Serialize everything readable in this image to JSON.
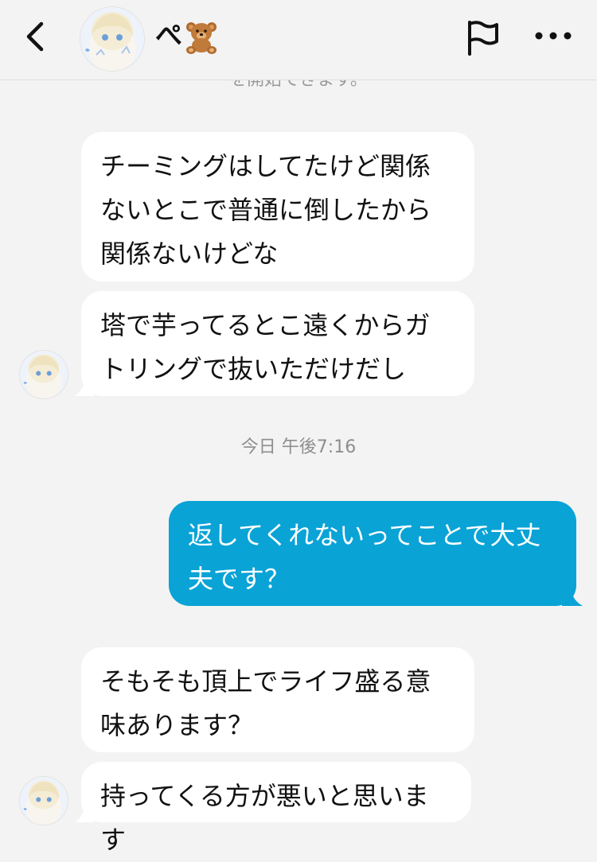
{
  "header": {
    "contact_name": "ぺ",
    "name_emoji_icon": "teddy-bear-icon",
    "back_icon": "chevron-left-icon",
    "flag_icon": "flag-icon",
    "more_icon": "more-dots-icon"
  },
  "clipped_text": "を開始できます。",
  "messages_before": [
    {
      "text": "チーミングはしてたけど関係ないとこで普通に倒したから関係ないけどな"
    },
    {
      "text": "塔で芋ってるとこ遠くからガトリングで抜いただけだし"
    }
  ],
  "timestamp": "今日 午後7:16",
  "sent_message": {
    "text": "返してくれないってことで大丈夫です？"
  },
  "messages_after": [
    {
      "text": "そもそも頂上でライフ盛る意味あります？"
    },
    {
      "text": "持ってくる方が悪いと思います"
    }
  ],
  "colors": {
    "background": "#f3f3f3",
    "incoming_bubble": "#ffffff",
    "outgoing_bubble": "#09a3d6",
    "outgoing_text": "#ffffff",
    "timestamp_text": "#8e8e8e"
  }
}
